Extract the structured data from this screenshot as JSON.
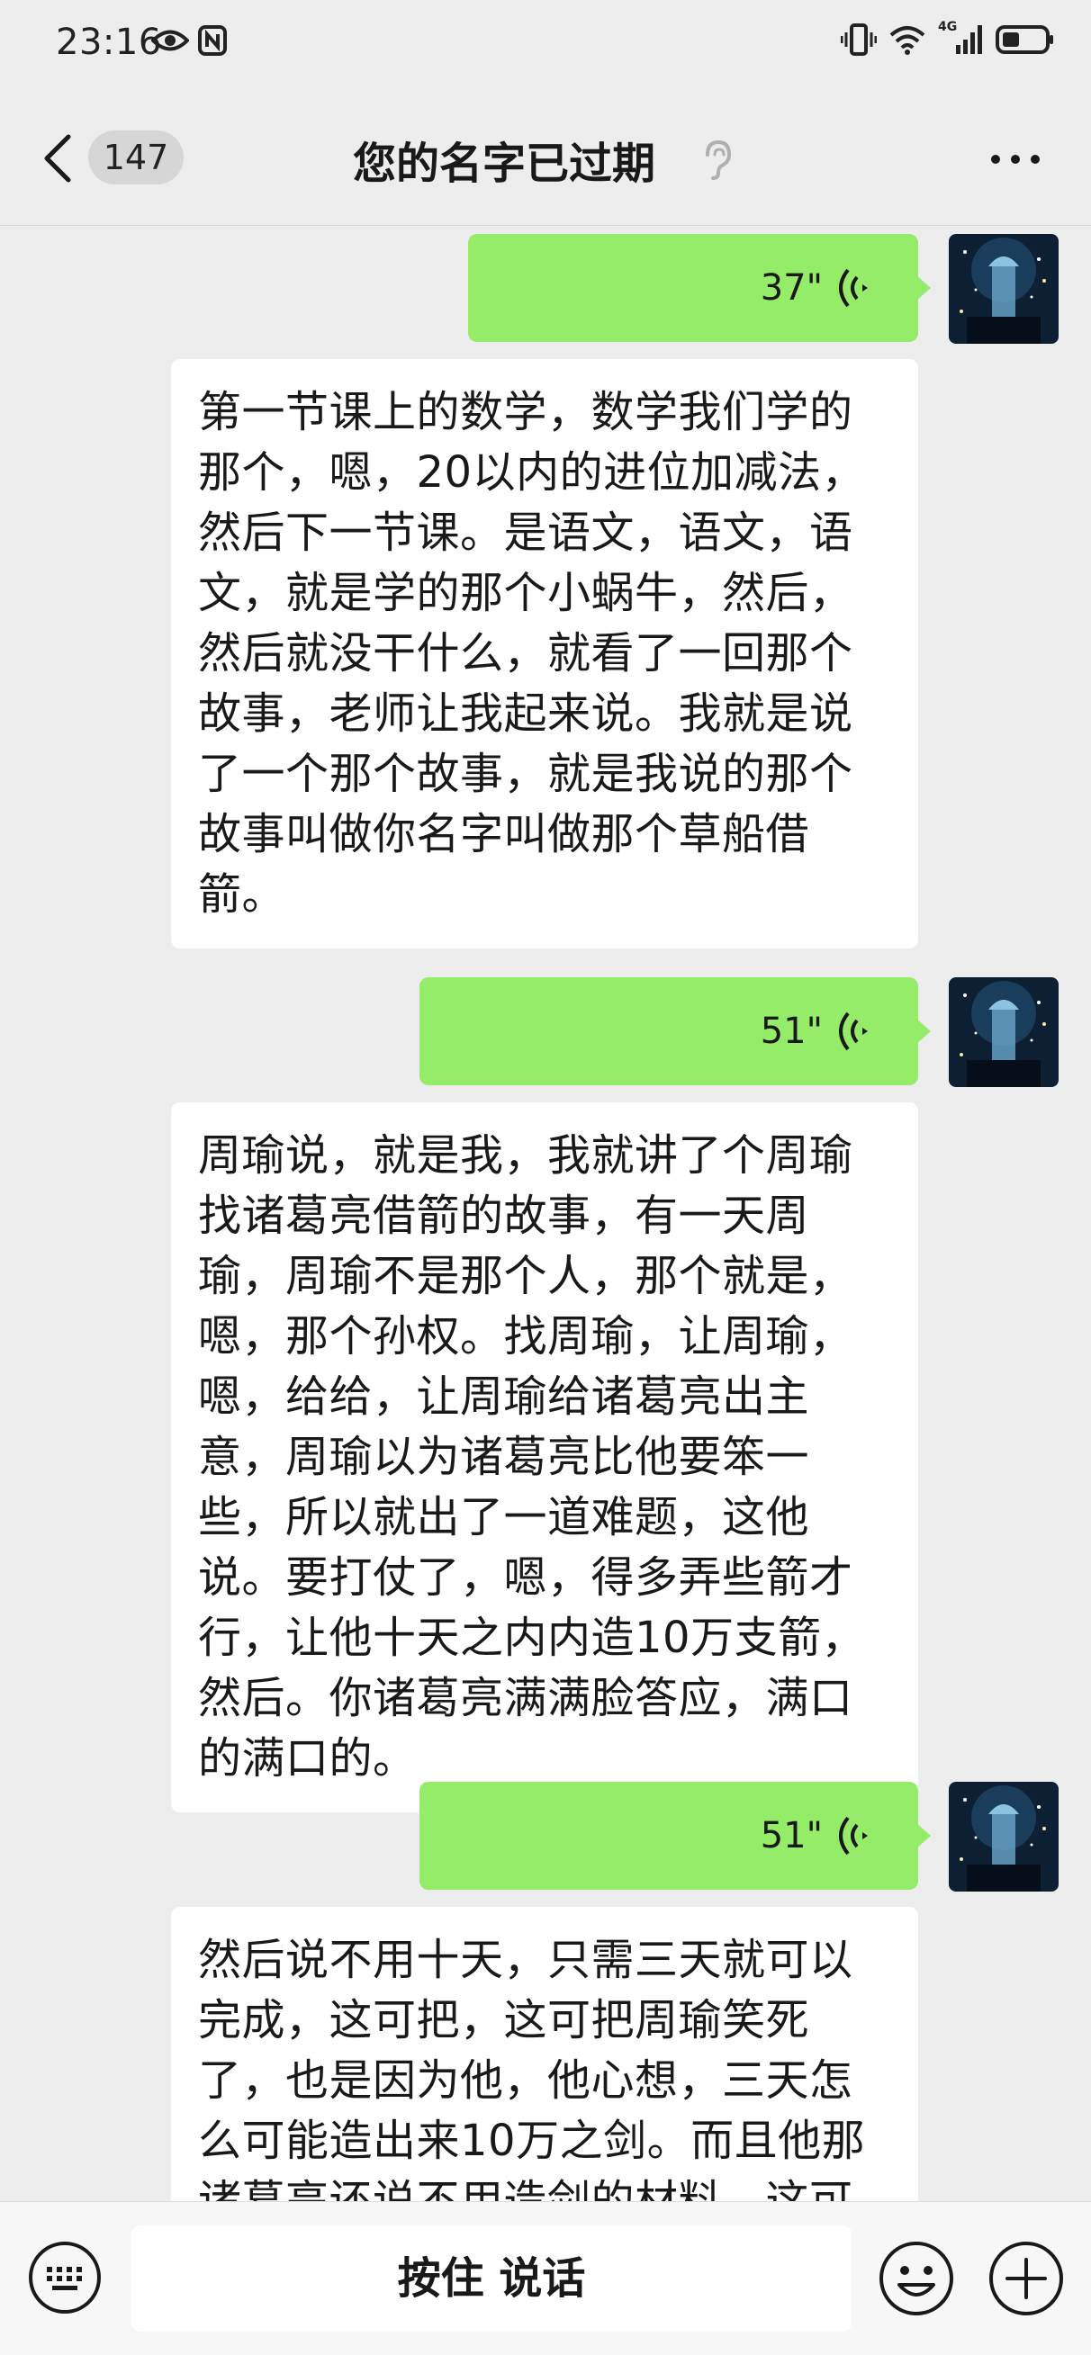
{
  "status_bar": {
    "time": "23:16",
    "network": "4G"
  },
  "nav": {
    "unread_count": "147",
    "title": "您的名字已过期"
  },
  "messages": [
    {
      "type": "voice",
      "duration": "37\""
    },
    {
      "type": "text",
      "text": "第一节课上的数学，数学我们学的那个，嗯，20以内的进位加减法，然后下一节课。是语文，语文，语文，就是学的那个小蜗牛，然后，然后就没干什么，就看了一回那个故事，老师让我起来说。我就是说了一个那个故事，就是我说的那个故事叫做你名字叫做那个草船借箭。"
    },
    {
      "type": "voice",
      "duration": "51\""
    },
    {
      "type": "text",
      "text": "周瑜说，就是我，我就讲了个周瑜找诸葛亮借箭的故事，有一天周瑜，周瑜不是那个人，那个就是，嗯，那个孙权。找周瑜，让周瑜，嗯，给给，让周瑜给诸葛亮出主意，周瑜以为诸葛亮比他要笨一些，所以就出了一道难题，这他说。要打仗了，嗯，得多弄些箭才行，让他十天之内内造10万支箭，然后。你诸葛亮满满脸答应，满口的满口的。"
    },
    {
      "type": "voice",
      "duration": "51\""
    },
    {
      "type": "text",
      "text": "然后说不用十天，只需三天就可以完成，这可把，这可把周瑜笑死了，也是因为他，他心想，三天怎么可能造出来10万之剑。而且他那诸葛亮还说不用造剑的材料，这可把周"
    }
  ],
  "input_bar": {
    "hold_to_talk": "按住 说话"
  },
  "colors": {
    "background": "#ededed",
    "sent_bubble": "#95ec69",
    "received_bubble": "#ffffff"
  }
}
